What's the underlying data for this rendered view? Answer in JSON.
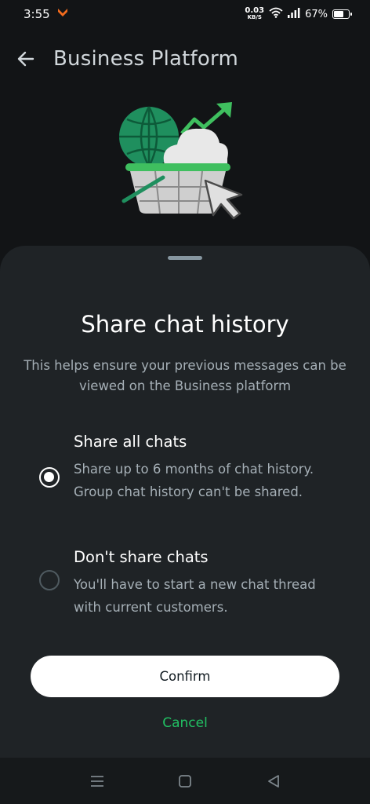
{
  "status_bar": {
    "time": "3:55",
    "net_speed_value": "0.03",
    "net_speed_unit": "KB/S",
    "battery_percent": "67%",
    "battery_level": 0.67,
    "icons": [
      "notification-app-icon",
      "wifi-icon",
      "signal-icon",
      "battery-icon"
    ]
  },
  "app_bar": {
    "title": "Business Platform",
    "back_icon": "arrow-left-icon"
  },
  "illustration": {
    "icon": "business-basket-illustration",
    "colors": {
      "green": "#1f8f5e",
      "bright_green": "#3fbf5f",
      "gray": "#c9c9c9",
      "cloud": "#e8e8e8"
    }
  },
  "sheet": {
    "title": "Share chat history",
    "description": "This helps ensure your previous messages can be viewed on the Business platform",
    "options": [
      {
        "label": "Share all chats",
        "description": "Share up to 6 months of chat history. Group chat history can't be shared.",
        "selected": true
      },
      {
        "label": "Don't share chats",
        "description": "You'll have to start a new chat thread with current customers.",
        "selected": false
      }
    ],
    "confirm_label": "Confirm",
    "cancel_label": "Cancel"
  },
  "nav_bar": {
    "icons": [
      "menu-icon",
      "home-icon",
      "back-triangle-icon"
    ]
  },
  "colors": {
    "background": "#121416",
    "sheet": "#1f2326",
    "accent_green": "#21c063",
    "secondary_text": "#a5afb6"
  }
}
